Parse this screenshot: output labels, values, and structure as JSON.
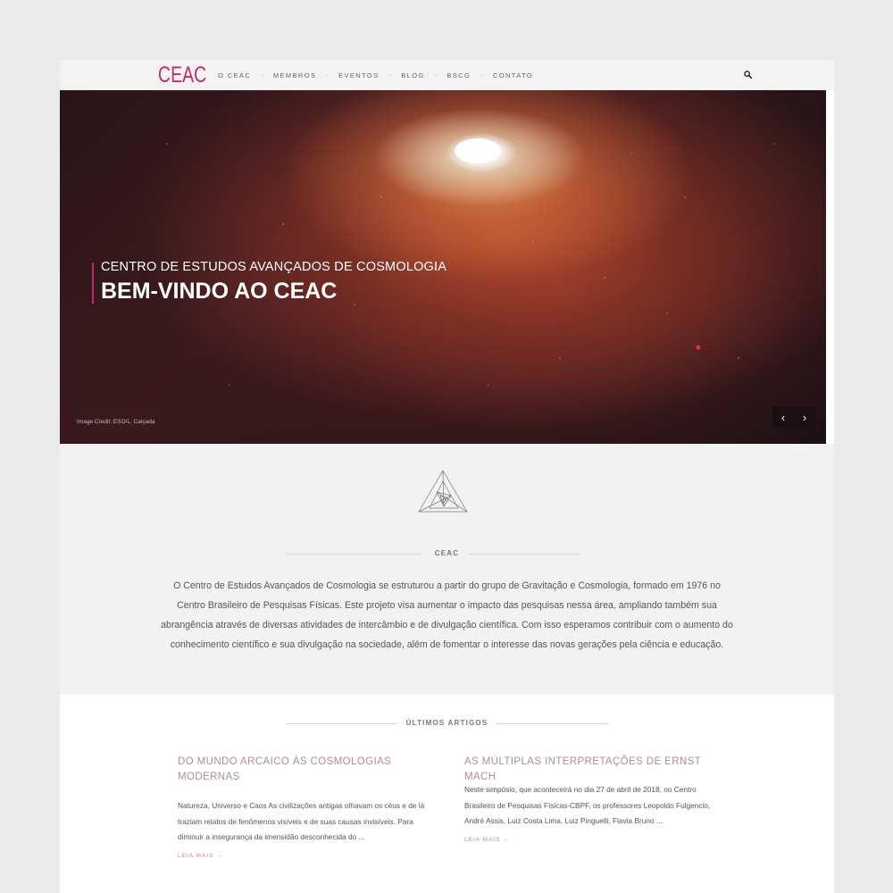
{
  "header": {
    "logo": "CEAC",
    "menu": [
      "O CEAC",
      "MEMBROS",
      "EVENTOS",
      "BLOG",
      "BSCG",
      "CONTATO"
    ],
    "separator": "·"
  },
  "hero": {
    "subtitle": "CENTRO DE ESTUDOS AVANÇADOS DE COSMOLOGIA",
    "title": "BEM-VINDO AO CEAC",
    "credit": "Image Credit: ESO/L. Calçada",
    "prev_glyph": "‹",
    "next_glyph": "›"
  },
  "about": {
    "heading": "CEAC",
    "text": "O Centro de Estudos Avançados de Cosmologia se estruturou a partir do grupo de Gravitação e Cosmologia, formado em 1976 no Centro Brasileiro de Pesquisas Físicas. Este projeto visa aumentar o impacto das pesquisas nessa área, ampliando também sua abrangência através de diversas atividades de intercâmbio e de divulgação científica. Com isso esperamos contribuir com o aumento do conhecimento científico e sua divulgação na sociedade, além de fomentar o interesse das novas gerações pela ciência e educação."
  },
  "articles": {
    "heading": "ÚLTIMOS ARTIGOS",
    "items": [
      {
        "title": "DO MUNDO ARCAICO ÀS COSMOLOGIAS MODERNAS",
        "excerpt": "Natureza, Universo e Caos As civilizações antigas olhavam os céus e de lá traziam relatos de fenômenos visíveis e de suas causas invisíveis. Para diminuir a insegurança da imensidão desconhecida do ...",
        "read_more": "LEIA MAIS →"
      },
      {
        "title": "AS MÚLTIPLAS INTERPRETAÇÕES DE ERNST MACH",
        "excerpt": "Neste simpósio, que aconteceirá no dia 27 de abril de 2018, no Centro Brasileiro de Pesquisas Físicas-CBPF, os professores Leopoldo Fulgencio, André Assis, Luiz Costa Lima, Luiz Pinguelli, Flavia Bruno ...",
        "read_more": "LEIA MAIS →"
      }
    ]
  },
  "colors": {
    "accent": "#c8286b",
    "article_title": "#b58a8f",
    "background": "#ebebeb"
  },
  "icons": {
    "search": "search-icon",
    "emblem": "triangle-spiral-logo-icon"
  }
}
